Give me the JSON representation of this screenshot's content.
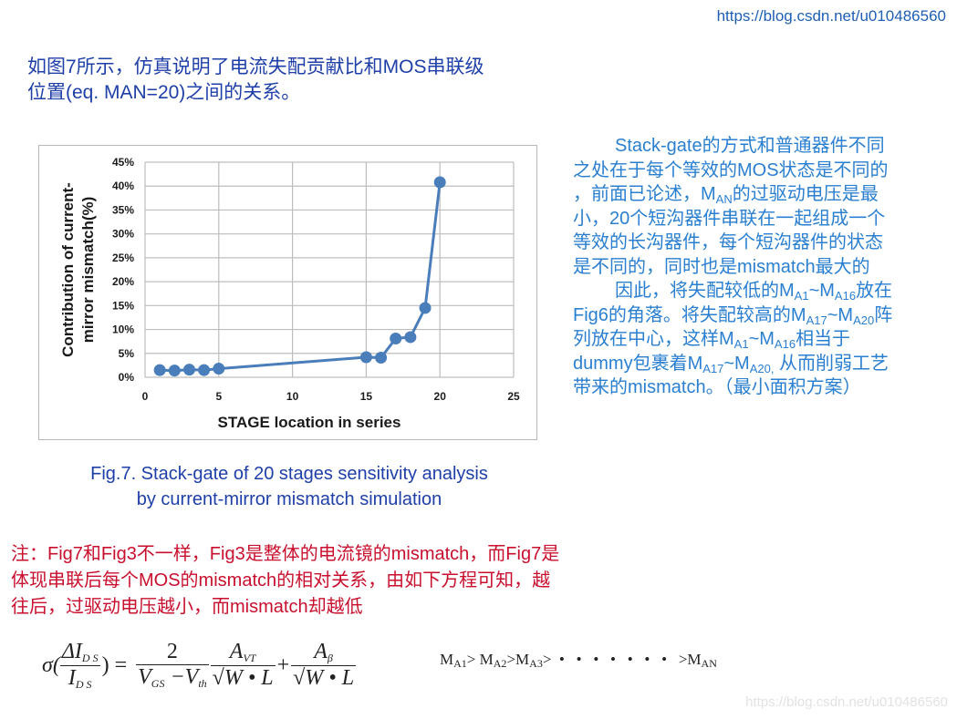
{
  "header": {
    "url": "https://blog.csdn.net/u010486560"
  },
  "intro_text": [
    "如图7所示，仿真说明了电流失配贡献比和MOS串联级",
    "位置(eq. MAN=20)之间的关系。"
  ],
  "right_panel": {
    "para1": {
      "line1": "Stack-gate的方式和普通器件不同",
      "line2": "之处在于每个等效的MOS状态是不同的",
      "line3_pre": "，前面已论述，M",
      "line3_sub": "AN",
      "line3_post": "的过驱动电压是最",
      "line4": "小，20个短沟器件串联在一起组成一个",
      "line5": "等效的长沟器件，每个短沟器件的状态",
      "line6": "是不同的，同时也是mismatch最大的"
    },
    "para2": {
      "l1_a": "因此，将失配较低的M",
      "l1_s1": "A1",
      "l1_b": "~M",
      "l1_s2": "A16",
      "l1_c": "放在",
      "l2_a": "Fig6的角落。将失配较高的M",
      "l2_s1": "A17",
      "l2_b": "~M",
      "l2_s2": "A20",
      "l2_c": "阵",
      "l3_a": "列放在中心，这样M",
      "l3_s1": "A1",
      "l3_b": "~M",
      "l3_s2": "A16",
      "l3_c": "相当于",
      "l4_a": "dummy包裹着M",
      "l4_s1": "A17",
      "l4_b": "~M",
      "l4_s2": "A20,",
      "l4_c": " 从而削弱工艺",
      "l5": "带来的mismatch。（最小面积方案）"
    }
  },
  "caption": [
    "Fig.7. Stack-gate of 20 stages sensitivity analysis",
    "by current-mirror mismatch simulation"
  ],
  "note": [
    "注：Fig7和Fig3不一样，Fig3是整体的电流镜的mismatch，而Fig7是",
    "体现串联后每个MOS的mismatch的相对关系，由如下方程可知，越",
    "往后，过驱动电压越小，而mismatch却越低"
  ],
  "formula": {
    "sigma": "σ(",
    "delta_num": "ΔI",
    "ds_sub": "D S",
    "den_I": "I",
    "close": ") =",
    "two": "2",
    "vgs": "V",
    "gs_sub": "GS",
    "minus": " −V",
    "th_sub": "th",
    "avt": "A",
    "vt_sub": "VT",
    "sqrt_wl": "√W • L",
    "plus": "+",
    "abeta": "A",
    "beta_sub": "β"
  },
  "inequality": {
    "m": "M",
    "s1": "A1",
    "g1": "> ",
    "s2": "A2",
    "g2": ">",
    "s3": "A3",
    "g3": ">",
    "dots": "  •   •   •   •   •   •   •   >",
    "sN": "AN"
  },
  "watermark": "https://blog.csdn.net/u010486560",
  "chart_data": {
    "type": "line",
    "title": "",
    "xlabel": "STAGE location in series",
    "ylabel": [
      "Contribution of  current-",
      "mirror  mismatch(%)"
    ],
    "x": [
      1,
      2,
      3,
      4,
      5,
      15,
      16,
      17,
      18,
      19,
      20
    ],
    "series": [
      {
        "name": "mismatch contribution",
        "values": [
          1.5,
          1.4,
          1.6,
          1.5,
          1.8,
          4.2,
          4.1,
          8.1,
          8.4,
          14.5,
          40.8
        ],
        "color": "#4a7ebb"
      }
    ],
    "xlim": [
      0,
      25
    ],
    "ylim": [
      0,
      45
    ],
    "xticks": [
      0,
      5,
      10,
      15,
      20,
      25
    ],
    "yticks": [
      0,
      5,
      10,
      15,
      20,
      25,
      30,
      35,
      40,
      45
    ],
    "ytick_labels": [
      "0%",
      "5%",
      "10%",
      "15%",
      "20%",
      "25%",
      "30%",
      "35%",
      "40%",
      "45%"
    ],
    "grid": true,
    "legend": "none",
    "gridcolor": "#bdbdbd"
  }
}
